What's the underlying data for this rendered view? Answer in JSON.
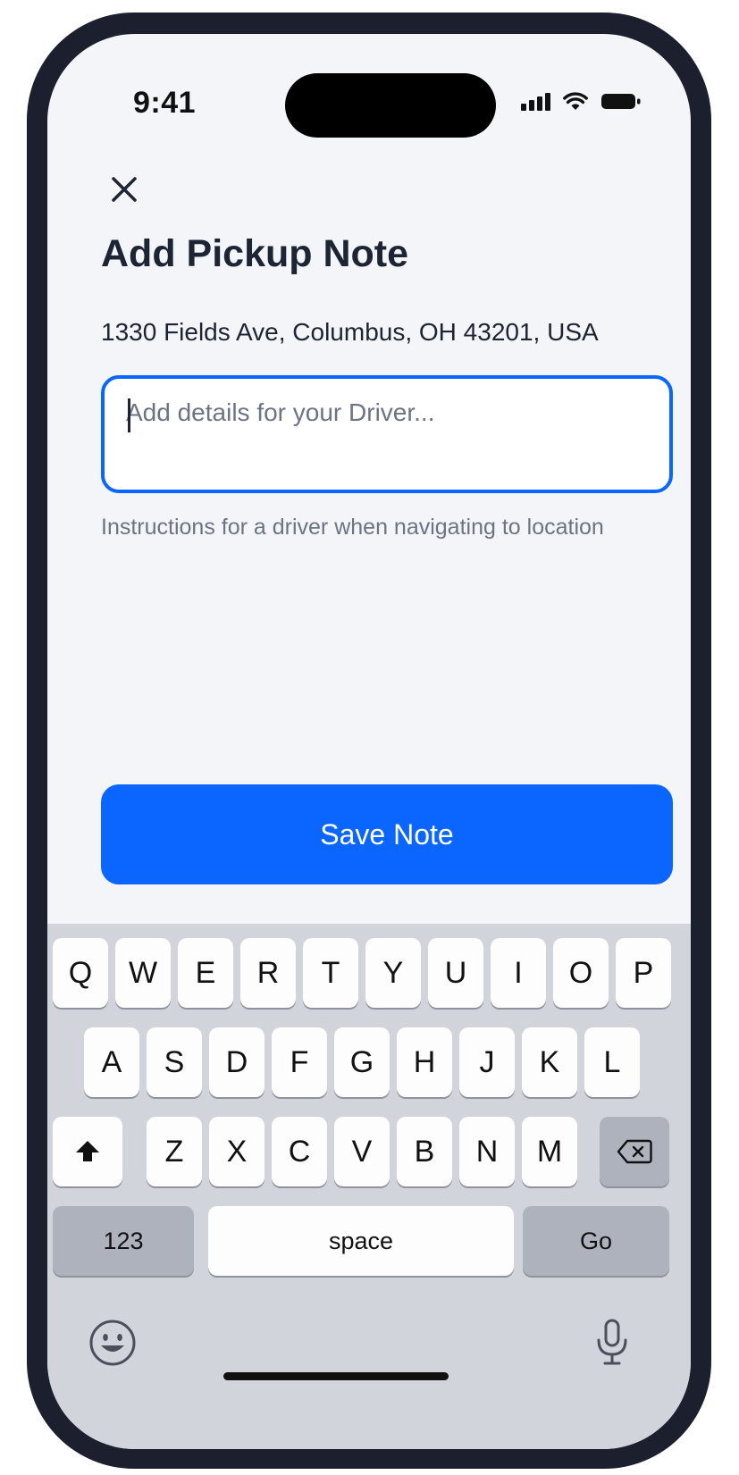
{
  "status_bar": {
    "time": "9:41",
    "signal_icon": "signal-icon",
    "wifi_icon": "wifi-icon",
    "battery_icon": "battery-icon"
  },
  "header": {
    "close_icon": "close-icon",
    "title": "Add Pickup Note"
  },
  "form": {
    "address": "1330 Fields Ave, Columbus, OH 43201, USA",
    "note_value": "",
    "note_placeholder": "Add details for your Driver...",
    "helper_text": "Instructions for a driver when navigating to location",
    "save_label": "Save Note"
  },
  "keyboard": {
    "row1": [
      "Q",
      "W",
      "E",
      "R",
      "T",
      "Y",
      "U",
      "I",
      "O",
      "P"
    ],
    "row2": [
      "A",
      "S",
      "D",
      "F",
      "G",
      "H",
      "J",
      "K",
      "L"
    ],
    "row3": [
      "Z",
      "X",
      "C",
      "V",
      "B",
      "N",
      "M"
    ],
    "numbers_label": "123",
    "space_label": "space",
    "go_label": "Go",
    "shift_icon": "shift-icon",
    "backspace_icon": "backspace-icon",
    "emoji_icon": "emoji-icon",
    "mic_icon": "microphone-icon"
  },
  "colors": {
    "accent": "#0a66ff",
    "screen_background": "#f4f5f8",
    "device_frame": "#1b1f2e",
    "keyboard_background": "#d1d4db"
  }
}
